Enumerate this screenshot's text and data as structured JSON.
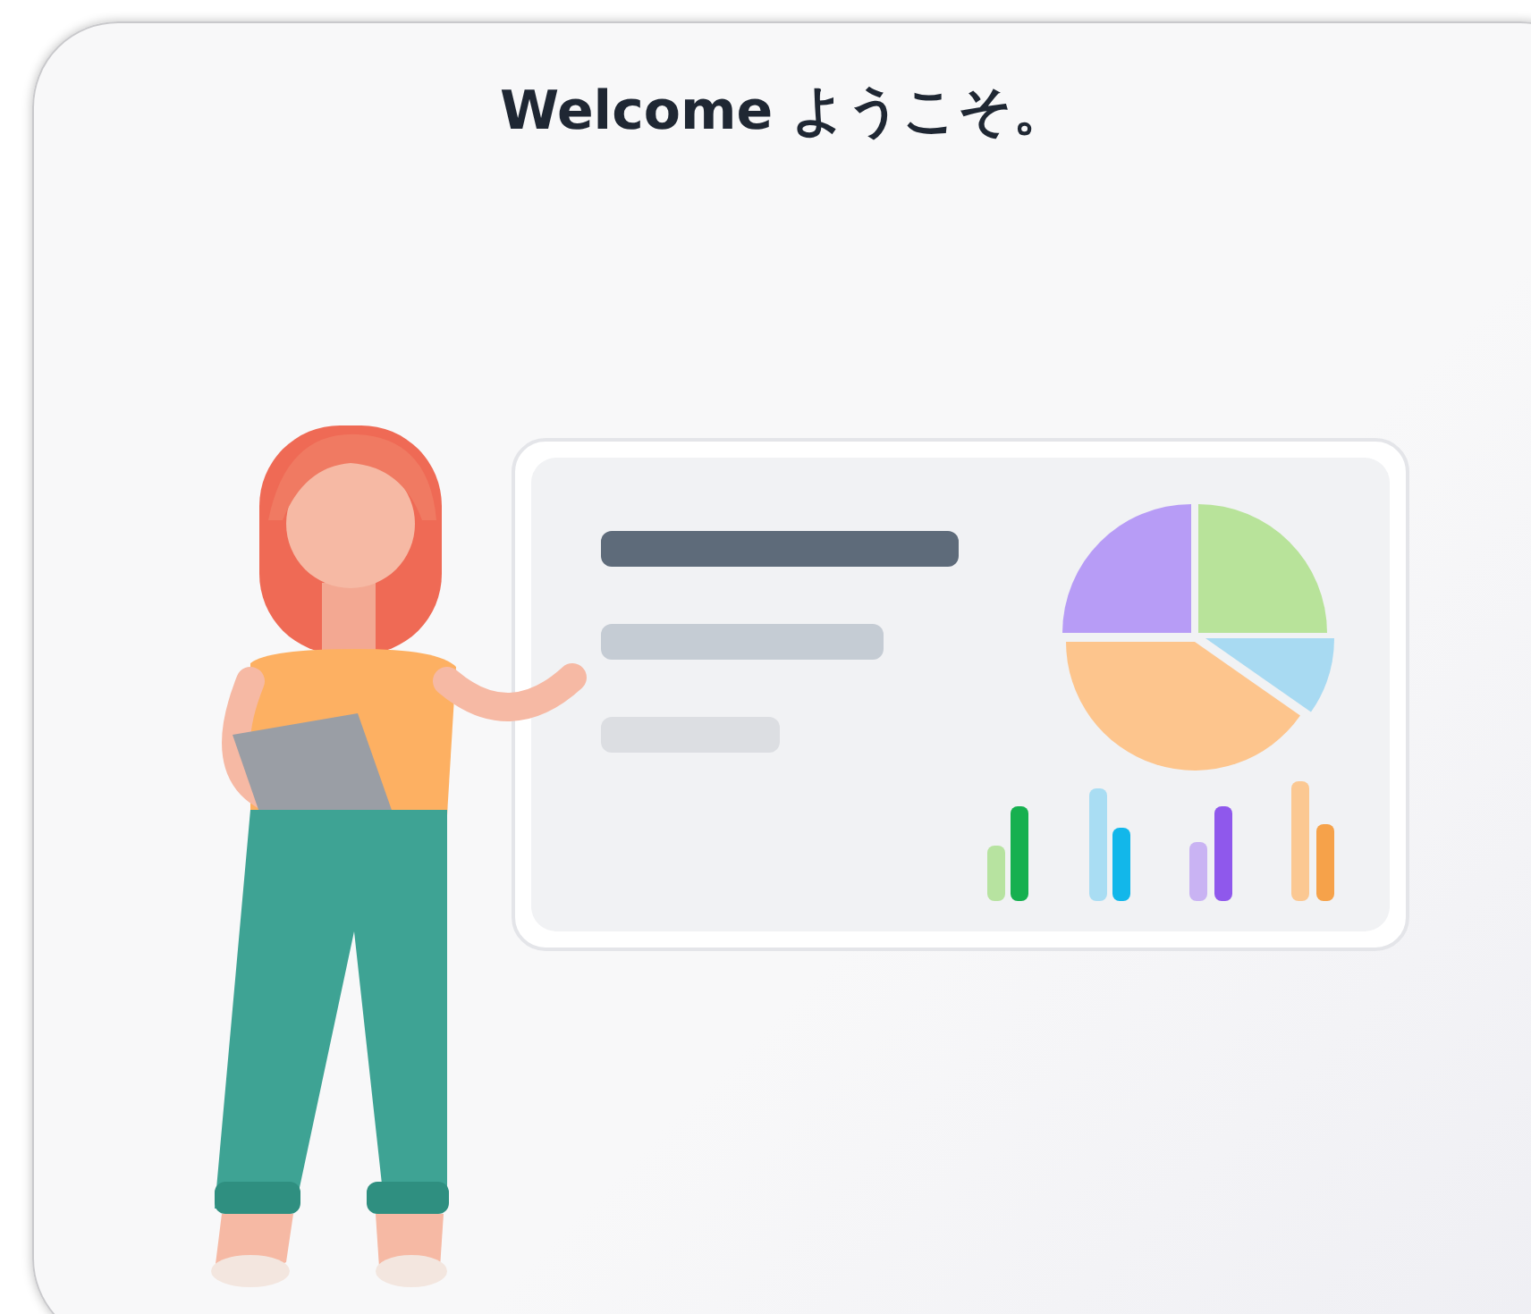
{
  "title": "Welcome ようこそ。"
}
